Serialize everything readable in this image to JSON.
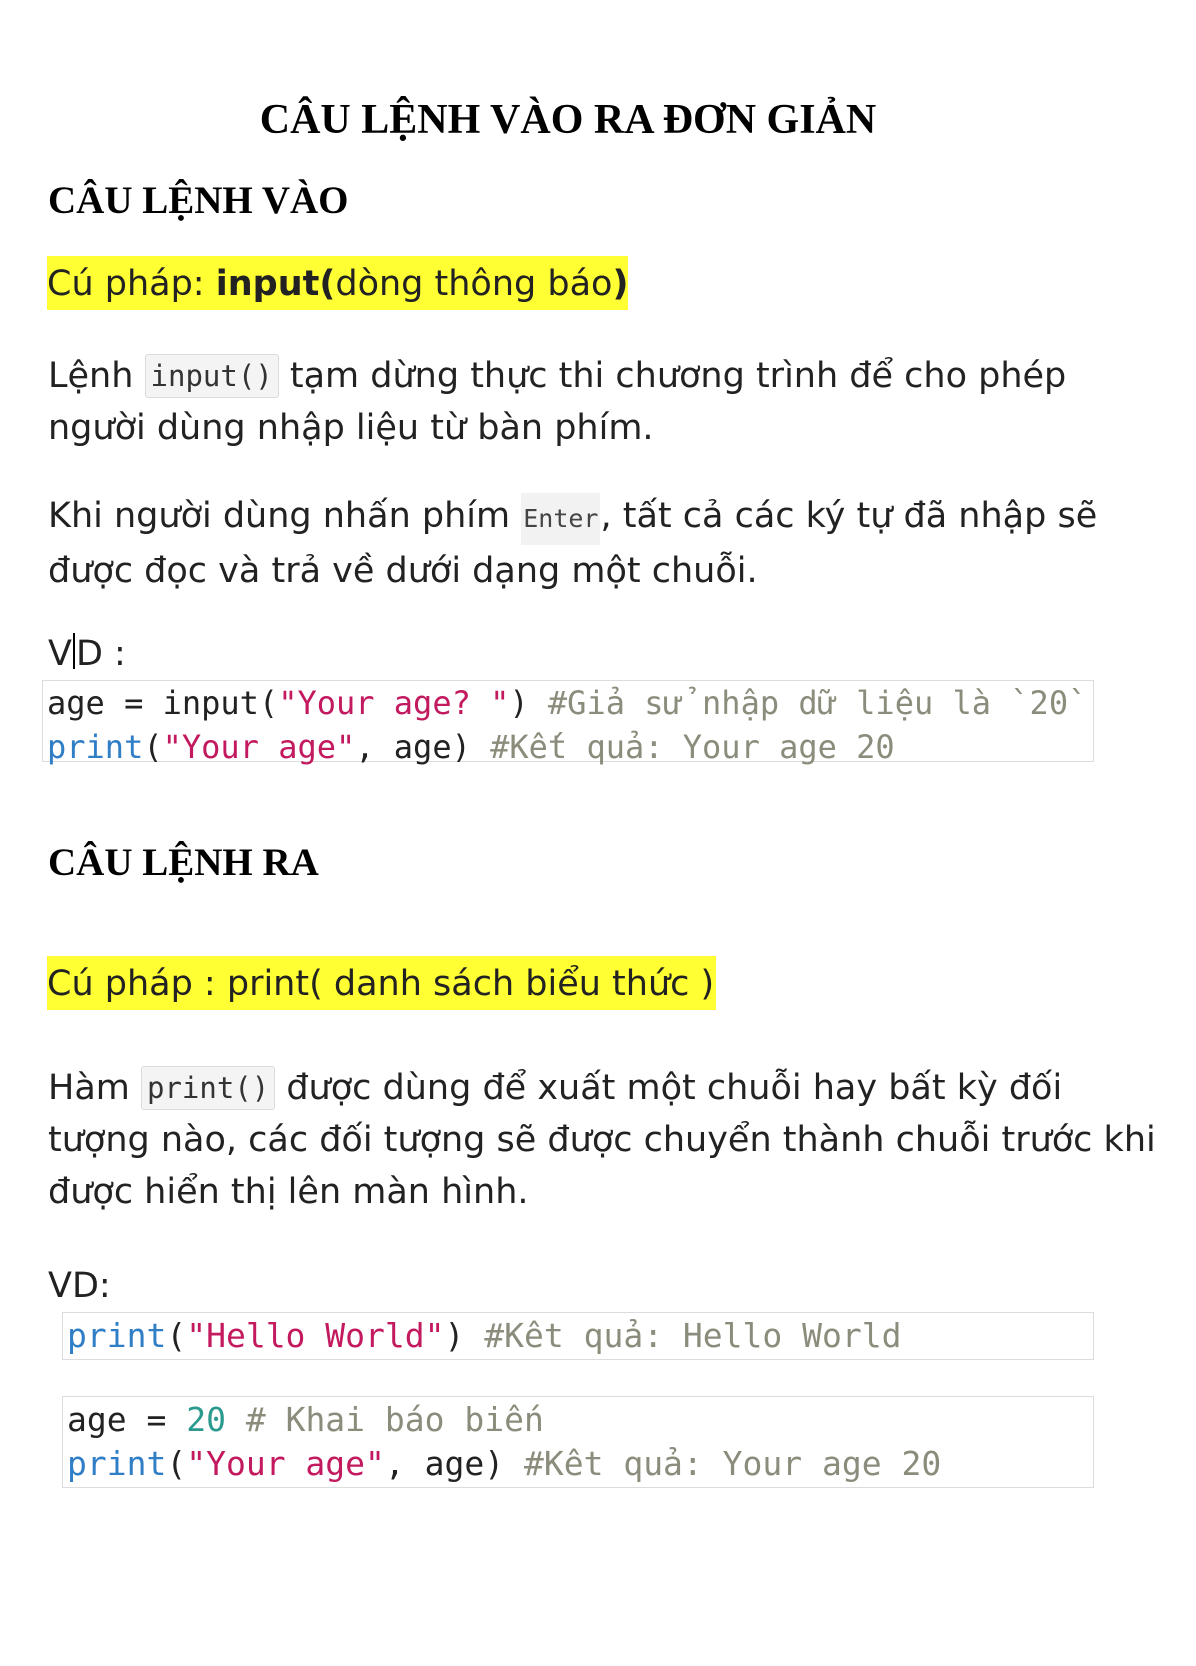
{
  "title": "CÂU LỆNH VÀO RA ĐƠN GIẢN",
  "section1": {
    "heading": "CÂU LỆNH VÀO",
    "syntax": {
      "prefix": "Cú pháp: ",
      "func": "input(",
      "arg": "dòng thông báo",
      "close": ")"
    },
    "para1": {
      "before": "Lệnh ",
      "code": "input()",
      "after": " tạm dừng thực thi chương trình để cho phép người dùng nhập liệu từ bàn phím."
    },
    "para2": {
      "before": "Khi người dùng nhấn phím ",
      "code": "Enter",
      "after": ", tất cả các ký tự đã nhập sẽ được đọc và trả về dưới dạng một chuỗi."
    },
    "example_label_a": "V",
    "example_label_b": "D :",
    "code": {
      "line1": {
        "var": "age = input(",
        "str": "\"Your age? \"",
        "close": ") ",
        "comment": "#Giả sử nhập dữ liệu là `20`"
      },
      "line2": {
        "kw": "print",
        "open": "(",
        "str": "\"Your age\"",
        "rest": ", age) ",
        "comment": "#Kết quả: Your age 20"
      }
    }
  },
  "section2": {
    "heading": "CÂU LỆNH RA",
    "syntax": "Cú pháp : print( danh sách biểu thức )",
    "para1": {
      "before": "Hàm ",
      "code": "print()",
      "after": " được dùng để xuất một chuỗi hay bất kỳ đối tượng nào, các đối tượng sẽ được chuyển thành chuỗi trước khi được hiển thị lên màn hình."
    },
    "example_label": "VD:",
    "code1": {
      "kw": "print",
      "open": "(",
      "str": "\"Hello World\"",
      "close": ") ",
      "comment": "#Kêt quả: Hello World"
    },
    "code2": {
      "line1": {
        "var": "age = ",
        "num": "20",
        "comment": " # Khai báo biến"
      },
      "line2": {
        "kw": "print",
        "open": "(",
        "str": "\"Your age\"",
        "rest": ", age) ",
        "comment": "#Kêt quả: Your age 20"
      }
    }
  }
}
